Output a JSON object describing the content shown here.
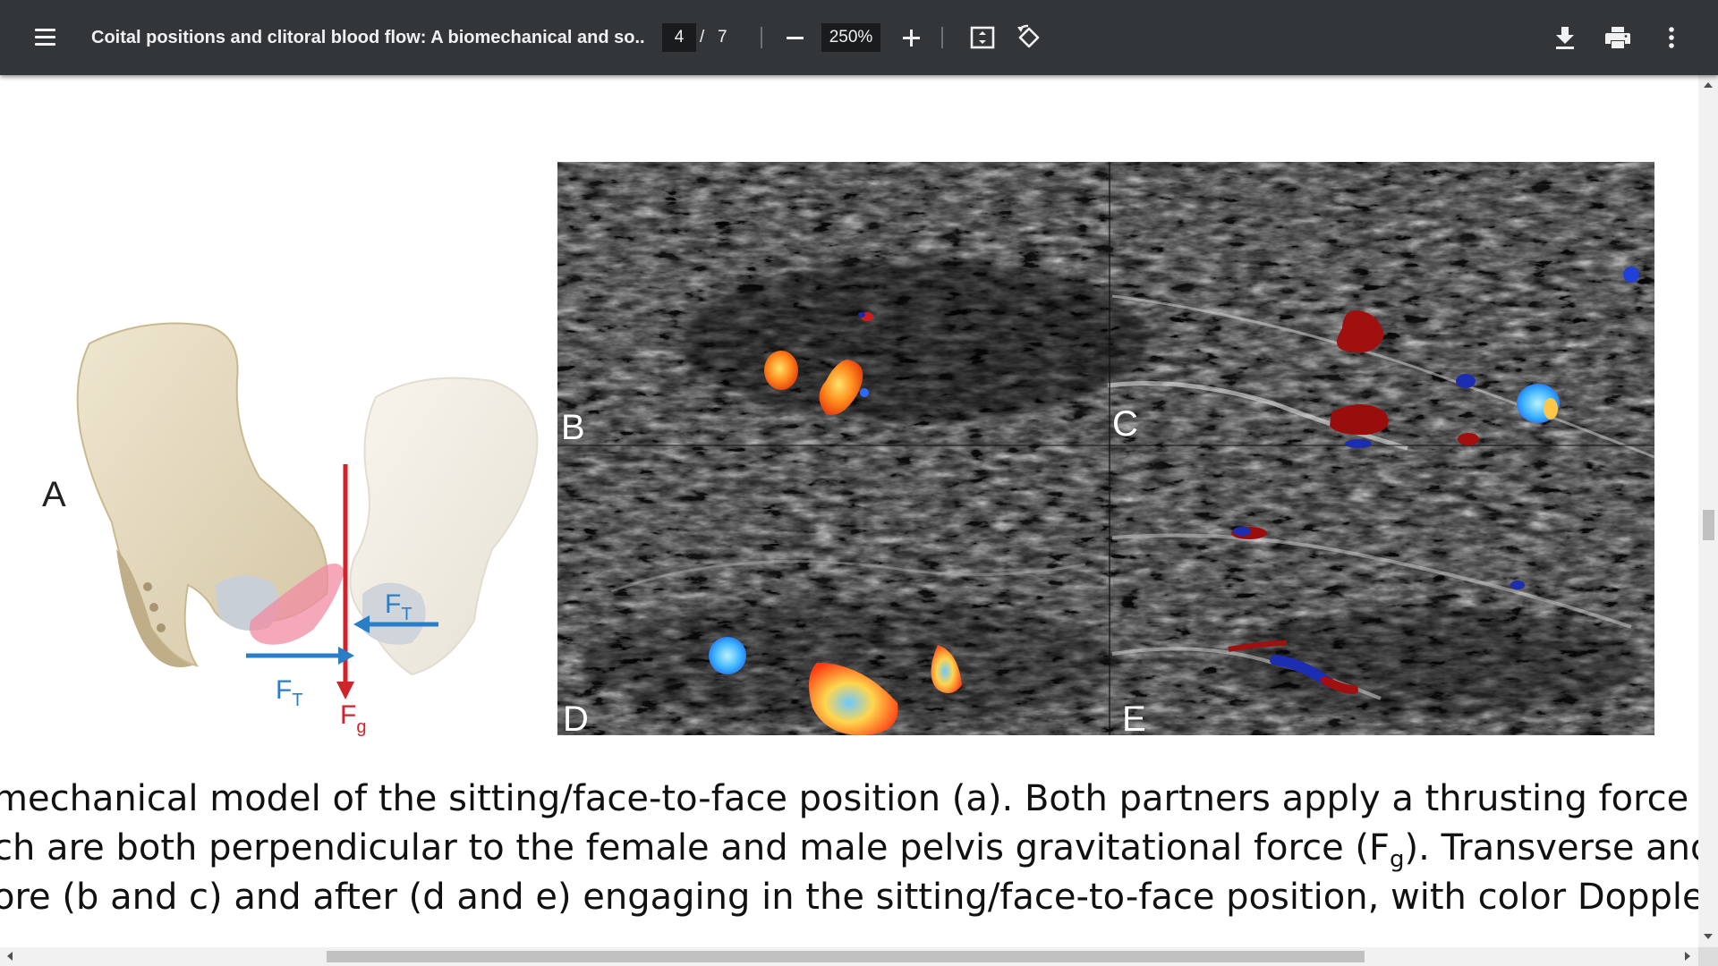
{
  "toolbar": {
    "title": "Coital positions and clitoral blood flow: A biomechanical and so...",
    "page_current": "4",
    "page_separator": "/",
    "page_total": "7",
    "zoom": "250%",
    "icons": [
      "menu-icon",
      "minus-icon",
      "plus-icon",
      "fit-page-icon",
      "rotate-icon",
      "download-icon",
      "print-icon",
      "more-vert-icon"
    ]
  },
  "figure": {
    "panel_a_label": "A",
    "force_t_main": "F",
    "force_t_sub": "T",
    "force_g_main": "F",
    "force_g_sub": "g",
    "panel_labels": {
      "b": "B",
      "c": "C",
      "d": "D",
      "e": "E"
    },
    "colors": {
      "force_t": "#2a7ec8",
      "force_g": "#d2232a"
    }
  },
  "caption": {
    "line1": "mechanical model of the sitting/face-to-face position (a). Both partners apply a thrusting force (",
    "line2_pre": "ch are both perpendicular to the female and male pelvis gravitational force (F",
    "line2_sub": "g",
    "line2_post": "). Transverse and s",
    "line3": "ore (b and c) and after (d and e) engaging in the sitting/face-to-face position, with color Doppler flo"
  }
}
